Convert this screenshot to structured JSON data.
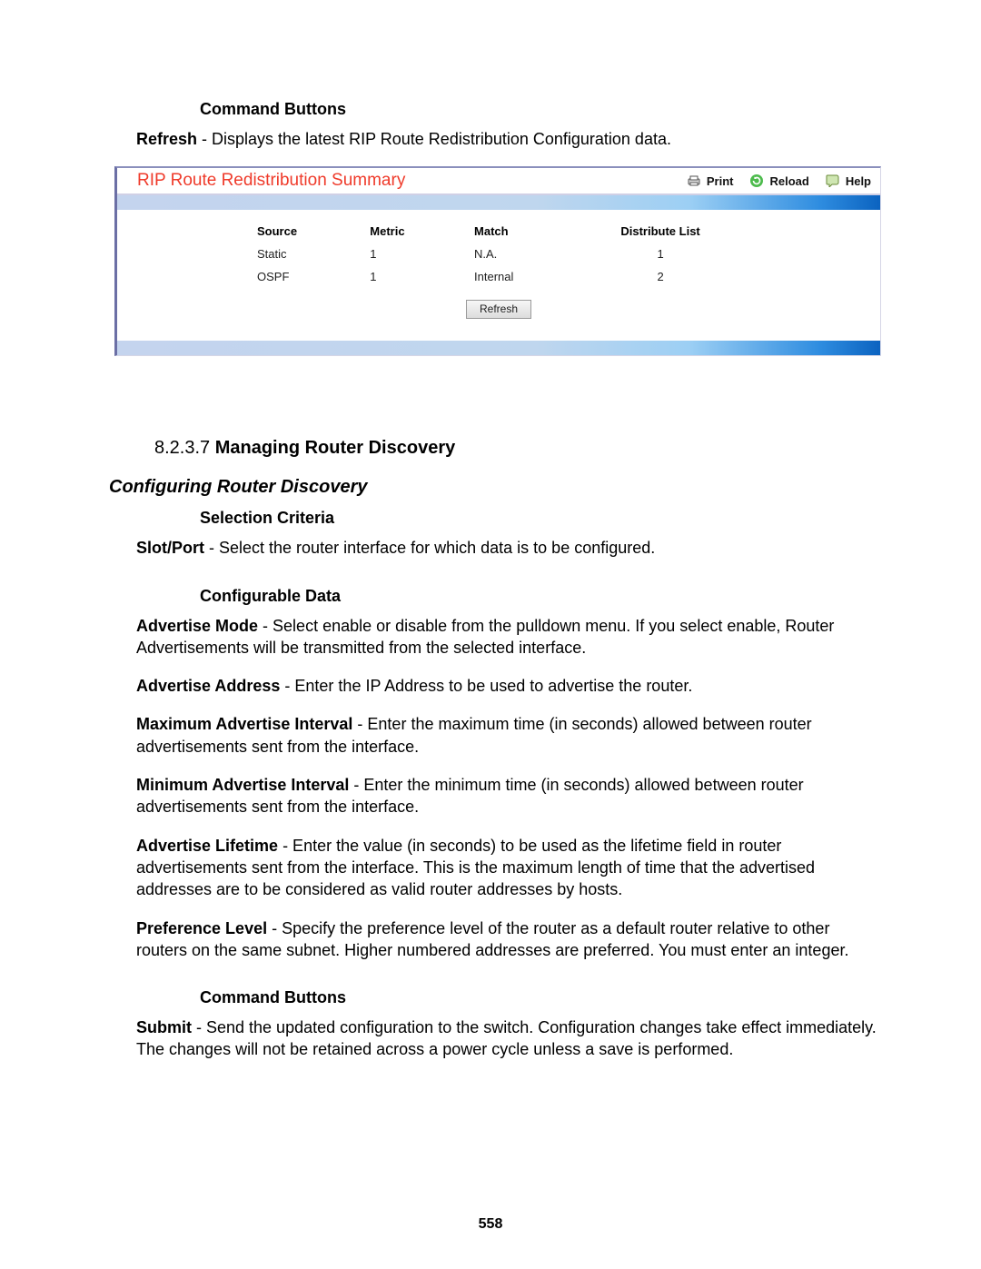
{
  "top": {
    "heading_command_buttons": "Command Buttons",
    "refresh_label": "Refresh",
    "refresh_desc": " - Displays the latest RIP Route Redistribution Configuration data."
  },
  "panel": {
    "title": "RIP Route Redistribution Summary",
    "actions": {
      "print": "Print",
      "reload": "Reload",
      "help": "Help"
    },
    "columns": {
      "source": "Source",
      "metric": "Metric",
      "match": "Match",
      "distribute": "Distribute List"
    },
    "rows": [
      {
        "source": "Static",
        "metric": "1",
        "match": "N.A.",
        "distribute": "1"
      },
      {
        "source": "OSPF",
        "metric": "1",
        "match": "Internal",
        "distribute": "2"
      }
    ],
    "refresh_button": "Refresh"
  },
  "section": {
    "number": "8.2.3.7 ",
    "title": "Managing Router Discovery"
  },
  "subsection": {
    "title": "Configuring Router Discovery"
  },
  "selection_criteria_heading": "Selection Criteria",
  "fields": {
    "slot_port": {
      "label": "Slot/Port",
      "desc": " - Select the router interface for which data is to be configured."
    }
  },
  "configurable_data_heading": "Configurable Data",
  "config_fields": {
    "advertise_mode": {
      "label": "Advertise Mode",
      "desc": " - Select enable or disable from the pulldown menu. If you select enable, Router Advertisements will be transmitted from the selected interface."
    },
    "advertise_address": {
      "label": "Advertise Address",
      "desc": " - Enter the IP Address to be used to advertise the router."
    },
    "max_interval": {
      "label": "Maximum Advertise Interval",
      "desc": " - Enter the maximum time (in seconds) allowed between router advertisements sent from the interface."
    },
    "min_interval": {
      "label": "Minimum Advertise Interval",
      "desc": " - Enter the minimum time (in seconds) allowed between router advertisements sent from the interface."
    },
    "advertise_life": {
      "label": "Advertise Lifetime",
      "desc": " - Enter the value (in seconds) to be used as the lifetime field in router advertisements sent from the interface. This is the maximum length of time that the advertised addresses are to be considered as valid router addresses by hosts."
    },
    "pref_level": {
      "label": "Preference Level",
      "desc": " - Specify the preference level of the router as a default router relative to other routers on the same subnet. Higher numbered addresses are preferred. You must enter an integer."
    }
  },
  "command_buttons_heading": "Command Buttons",
  "submit": {
    "label": "Submit",
    "desc": " - Send the updated configuration to the switch. Configuration changes take effect immediately. The changes will not be retained across a power cycle unless a save is performed."
  },
  "page_number": "558"
}
